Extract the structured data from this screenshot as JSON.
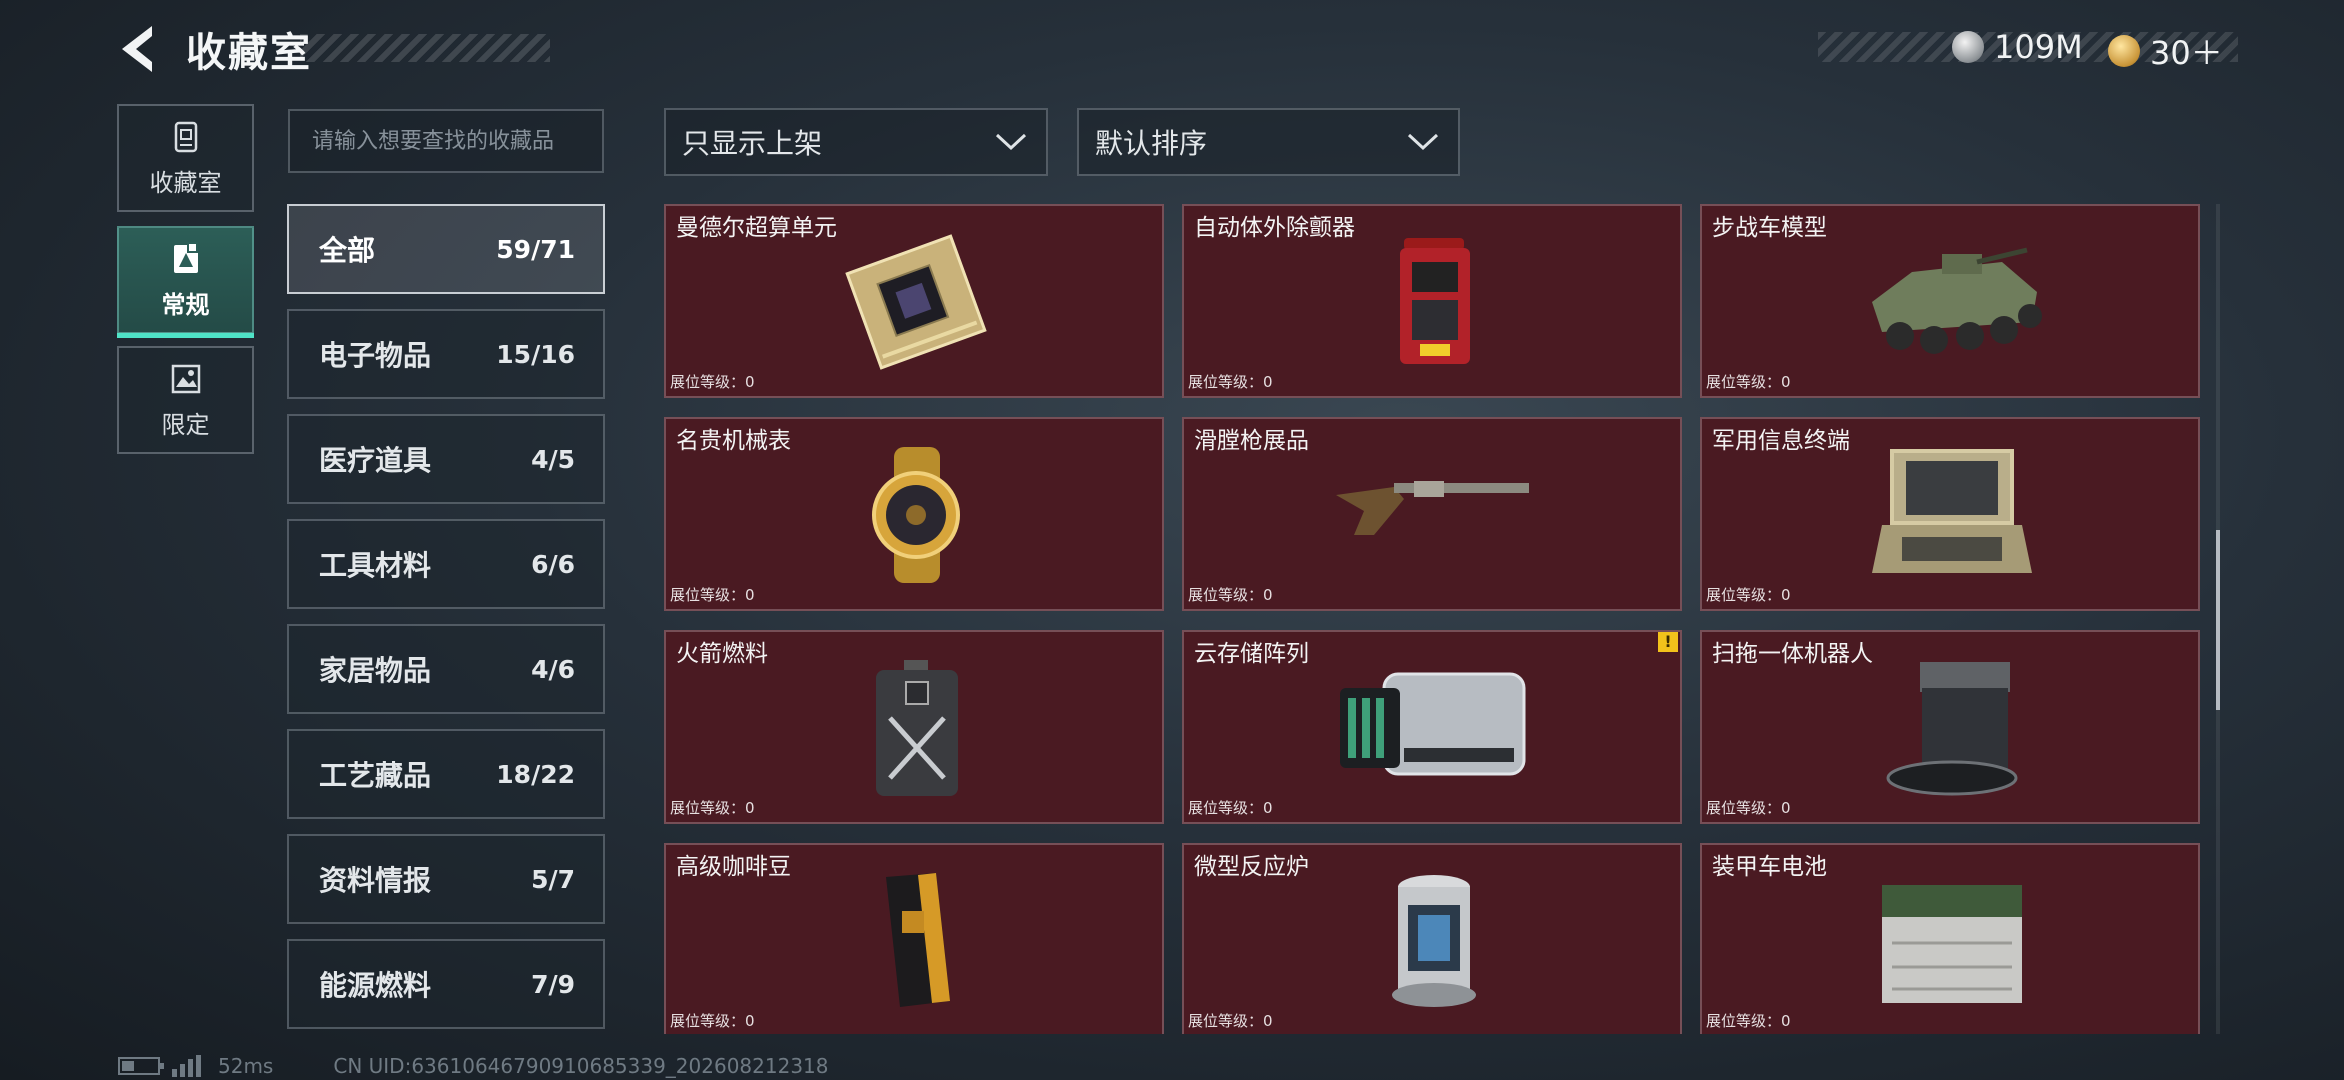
{
  "header": {
    "title": "收藏室",
    "currencies": [
      {
        "icon": "silver-coin-icon",
        "value": "109M"
      },
      {
        "icon": "gold-coin-icon",
        "value": "30＋"
      }
    ]
  },
  "nav": [
    {
      "icon": "collection-room-icon",
      "label": "收藏室",
      "active": false
    },
    {
      "icon": "regular-card-icon",
      "label": "常规",
      "active": true
    },
    {
      "icon": "limited-image-icon",
      "label": "限定",
      "active": false
    }
  ],
  "search": {
    "placeholder": "请输入想要查找的收藏品",
    "value": ""
  },
  "categories": [
    {
      "label": "全部",
      "count": "59/71",
      "active": true
    },
    {
      "label": "电子物品",
      "count": "15/16"
    },
    {
      "label": "医疗道具",
      "count": "4/5"
    },
    {
      "label": "工具材料",
      "count": "6/6"
    },
    {
      "label": "家居物品",
      "count": "4/6"
    },
    {
      "label": "工艺藏品",
      "count": "18/22"
    },
    {
      "label": "资料情报",
      "count": "5/7"
    },
    {
      "label": "能源燃料",
      "count": "7/9"
    }
  ],
  "filters": {
    "display": "只显示上架",
    "sort": "默认排序"
  },
  "level_prefix": "展位等级：",
  "items": [
    {
      "name": "曼德尔超算单元",
      "level": "0",
      "icon": "supercomputer-unit-icon"
    },
    {
      "name": "自动体外除颤器",
      "level": "0",
      "icon": "defibrillator-icon"
    },
    {
      "name": "步战车模型",
      "level": "0",
      "icon": "ifv-model-icon"
    },
    {
      "name": "名贵机械表",
      "level": "0",
      "icon": "luxury-watch-icon"
    },
    {
      "name": "滑膛枪展品",
      "level": "0",
      "icon": "musket-icon"
    },
    {
      "name": "军用信息终端",
      "level": "0",
      "icon": "military-terminal-icon"
    },
    {
      "name": "火箭燃料",
      "level": "0",
      "icon": "rocket-fuel-icon"
    },
    {
      "name": "云存储阵列",
      "level": "0",
      "icon": "cloud-storage-array-icon",
      "warning": "!"
    },
    {
      "name": "扫拖一体机器人",
      "level": "0",
      "icon": "robot-vacuum-icon"
    },
    {
      "name": "高级咖啡豆",
      "level": "0",
      "icon": "coffee-beans-icon"
    },
    {
      "name": "微型反应炉",
      "level": "0",
      "icon": "micro-reactor-icon"
    },
    {
      "name": "装甲车电池",
      "level": "0",
      "icon": "armored-battery-icon"
    }
  ],
  "footer": {
    "ping": "52ms",
    "uid": "CN UID:63610646790910685339_202608212318"
  }
}
